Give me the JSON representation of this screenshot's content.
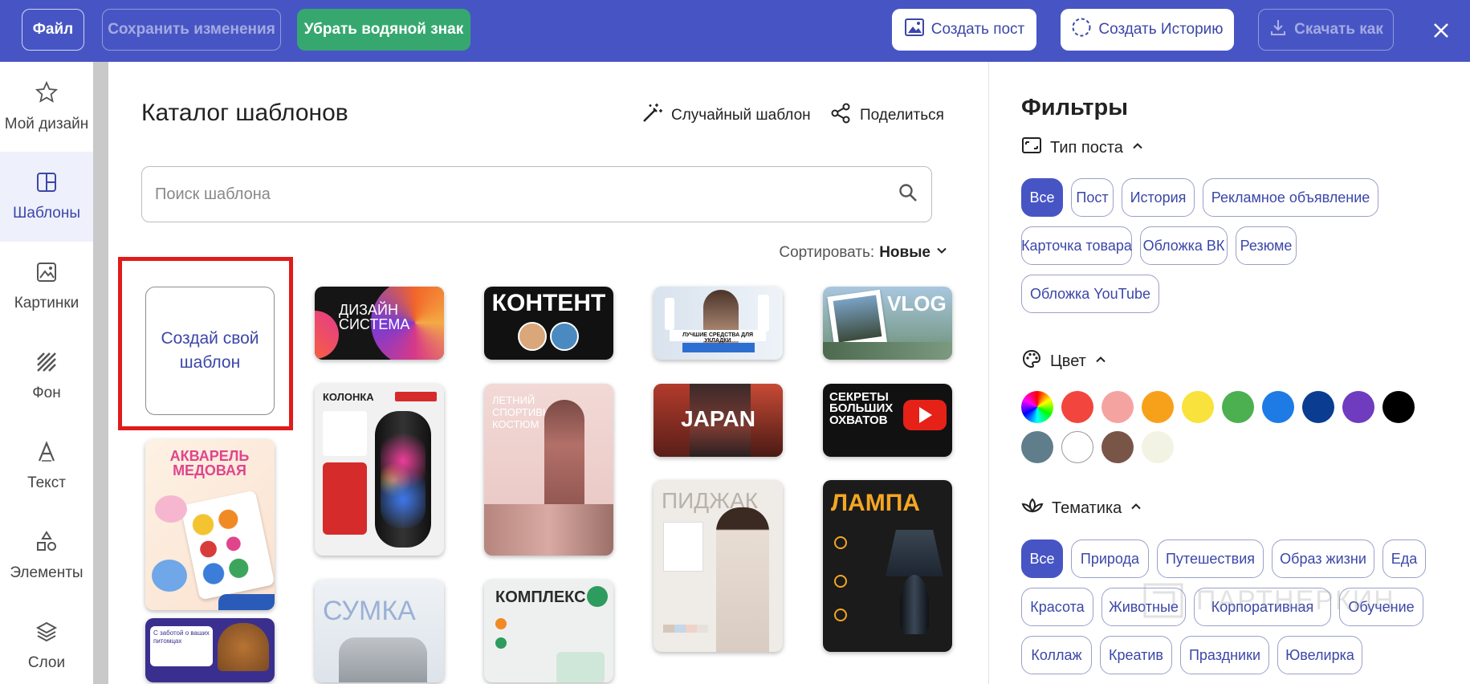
{
  "topbar": {
    "file_label": "Файл",
    "save_label": "Сохранить изменения",
    "watermark_label": "Убрать водяной знак",
    "create_post_label": "Создать пост",
    "create_story_label": "Создать Историю",
    "download_label": "Скачать как"
  },
  "sidebar": {
    "items": [
      {
        "label": "Мой дизайн",
        "icon": "star-icon"
      },
      {
        "label": "Шаблоны",
        "icon": "template-icon"
      },
      {
        "label": "Картинки",
        "icon": "image-icon"
      },
      {
        "label": "Фон",
        "icon": "background-icon"
      },
      {
        "label": "Текст",
        "icon": "text-icon"
      },
      {
        "label": "Элементы",
        "icon": "shapes-icon"
      },
      {
        "label": "Слои",
        "icon": "layers-icon"
      }
    ]
  },
  "catalog": {
    "title": "Каталог шаблонов",
    "random_label": "Случайный шаблон",
    "share_label": "Поделиться",
    "search_placeholder": "Поиск шаблона",
    "sort_prefix": "Сортировать:",
    "sort_value": "Новые",
    "create_label": "Создай свой шаблон",
    "templates": [
      {
        "text": "ДИЗАЙН СИСТЕМА"
      },
      {
        "text": "КОНТЕНТ"
      },
      {
        "text": "ЛУЧШИЕ СРЕДСТВА ДЛЯ УКЛАДКИ"
      },
      {
        "text": "VLOG"
      },
      {
        "text": "АКВАРЕЛЬ МЕДОВАЯ"
      },
      {
        "text": "КОЛОНКА"
      },
      {
        "text": "ЛЕТНИЙ СПОРТИВНЫЙ КОСТЮМ"
      },
      {
        "text": "JAPAN"
      },
      {
        "text": "СЕКРЕТЫ БОЛЬШИХ ОХВАТОВ"
      },
      {
        "text": "ПИДЖАК"
      },
      {
        "text": "ЛАМПА"
      },
      {
        "text": "СУМКА"
      },
      {
        "text": "КОМПЛЕКС"
      },
      {
        "text": "С заботой о ваших питомцах"
      }
    ]
  },
  "filters": {
    "title": "Фильтры",
    "post_type_label": "Тип поста",
    "post_types": [
      "Все",
      "Пост",
      "История",
      "Рекламное объявление",
      "Карточка товара",
      "Обложка ВК",
      "Резюме",
      "Обложка YouTube"
    ],
    "color_label": "Цвет",
    "colors": [
      "#f2453e",
      "#f5a3a1",
      "#f7a11a",
      "#f9e23b",
      "#4caf50",
      "#1e7be6",
      "#0a3d91",
      "#6f3bbf",
      "#000000",
      "#607d8b",
      "#ffffff",
      "#795548",
      "#f3f3e3"
    ],
    "theme_label": "Тематика",
    "themes": [
      "Все",
      "Природа",
      "Путешествия",
      "Образ жизни",
      "Еда",
      "Красота",
      "Животные",
      "Корпоративная",
      "Обучение",
      "Коллаж",
      "Креатив",
      "Праздники",
      "Ювелирка"
    ]
  },
  "watermark": {
    "text": "ПАРТНЕРКИН"
  }
}
